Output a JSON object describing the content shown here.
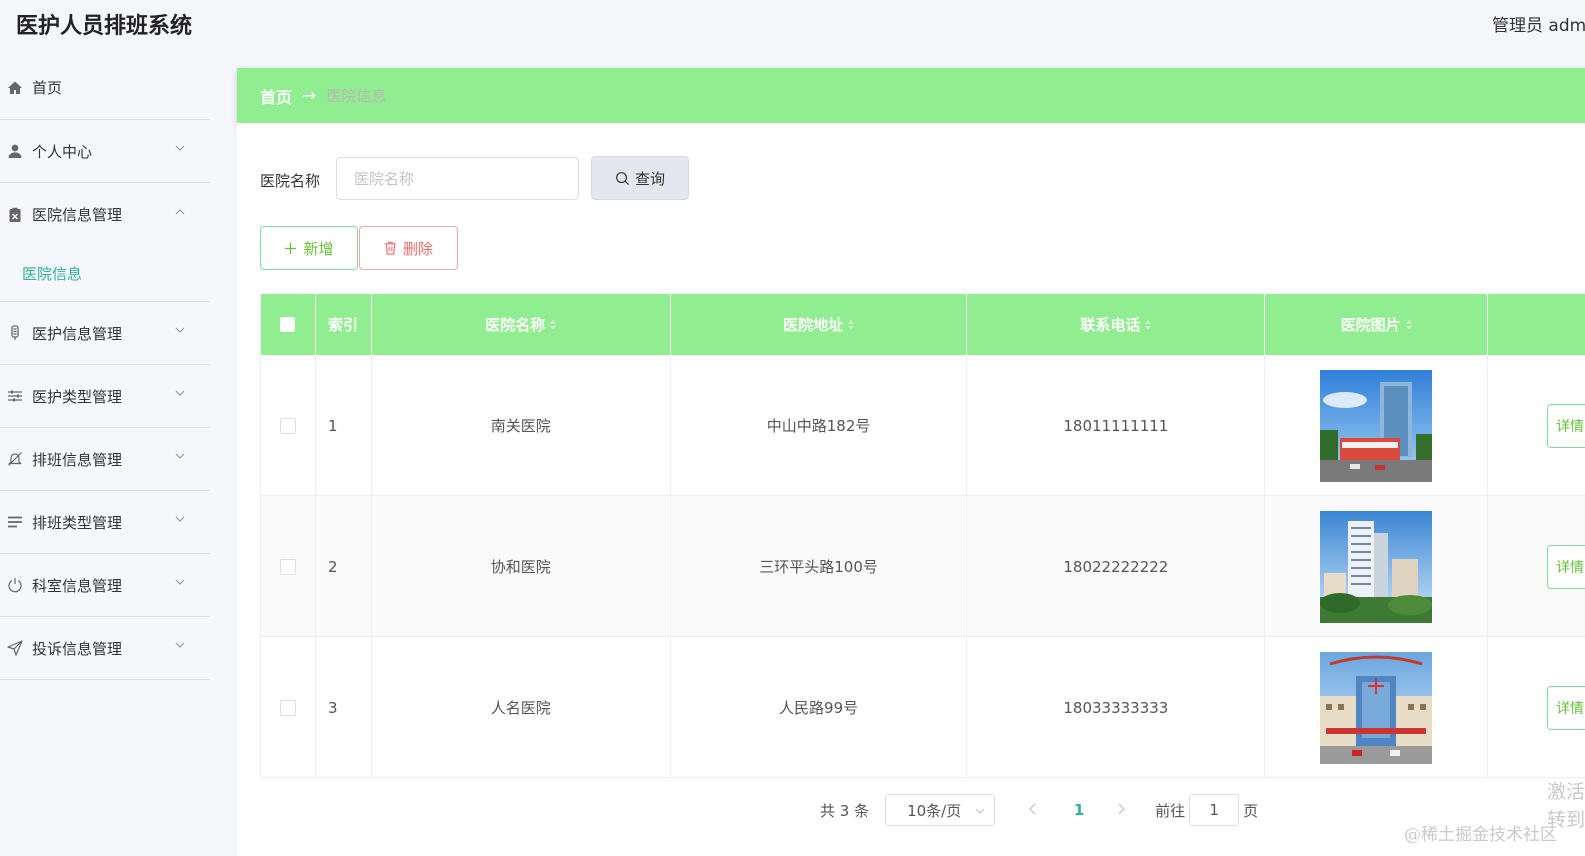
{
  "app": {
    "title": "医护人员排班系统",
    "user": "管理员 admin"
  },
  "sidebar": {
    "items": [
      {
        "label": "首页",
        "icon": "home-icon"
      },
      {
        "label": "个人中心",
        "icon": "user-icon"
      },
      {
        "label": "医院信息管理",
        "icon": "clipboard-icon",
        "expanded": true,
        "children": [
          {
            "label": "医院信息"
          }
        ]
      },
      {
        "label": "医护信息管理",
        "icon": "thermometer-icon"
      },
      {
        "label": "医护类型管理",
        "icon": "sliders-icon"
      },
      {
        "label": "排班信息管理",
        "icon": "bell-off-icon"
      },
      {
        "label": "排班类型管理",
        "icon": "list-icon"
      },
      {
        "label": "科室信息管理",
        "icon": "power-icon"
      },
      {
        "label": "投诉信息管理",
        "icon": "send-icon"
      }
    ]
  },
  "breadcrumb": {
    "home": "首页",
    "arrow": "→",
    "current": "医院信息"
  },
  "search": {
    "label": "医院名称",
    "placeholder": "医院名称",
    "value": "",
    "query_label": "查询"
  },
  "toolbar": {
    "add_label": "新增",
    "delete_label": "删除"
  },
  "table": {
    "headers": [
      "",
      "索引",
      "医院名称",
      "医院地址",
      "联系电话",
      "医院图片",
      ""
    ],
    "rows": [
      {
        "index": "1",
        "name": "南关医院",
        "address": "中山中路182号",
        "phone": "18011111111",
        "action": "详情"
      },
      {
        "index": "2",
        "name": "协和医院",
        "address": "三环平头路100号",
        "phone": "18022222222",
        "action": "详情"
      },
      {
        "index": "3",
        "name": "人名医院",
        "address": "人民路99号",
        "phone": "18033333333",
        "action": "详情"
      }
    ]
  },
  "pagination": {
    "total": "共 3 条",
    "page_size": "10条/页",
    "current_page": "1",
    "goto_label": "前往",
    "goto_value": "1",
    "page_suffix": "页"
  },
  "watermark": {
    "text": "@稀土掘金技术社区",
    "side_line1": "激活",
    "side_line2": "转到"
  },
  "colors": {
    "accent_green": "#90ee90",
    "active_teal": "#2fb39a",
    "add_green": "#67c23a",
    "delete_red": "#f56c6c"
  }
}
